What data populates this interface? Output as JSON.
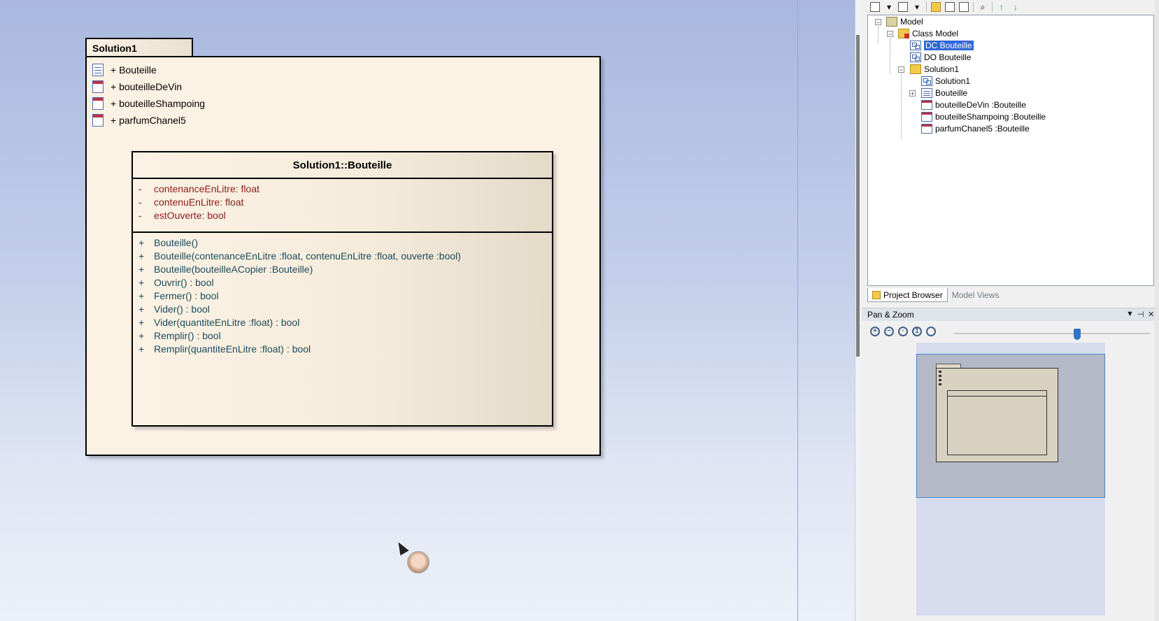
{
  "diagram": {
    "package": {
      "name": "Solution1",
      "items": [
        {
          "label": "+ Bouteille",
          "icon": "class-icon"
        },
        {
          "label": "+ bouteilleDeVin",
          "icon": "object-icon"
        },
        {
          "label": "+ bouteilleShampoing",
          "icon": "object-icon"
        },
        {
          "label": "+ parfumChanel5",
          "icon": "object-icon"
        }
      ]
    },
    "class": {
      "title": "Solution1::Bouteille",
      "attributes": [
        {
          "vis": "-",
          "text": "contenanceEnLitre:  float"
        },
        {
          "vis": "-",
          "text": "contenuEnLitre:  float"
        },
        {
          "vis": "-",
          "text": "estOuverte:  bool"
        }
      ],
      "operations": [
        {
          "vis": "+",
          "text": "Bouteille()"
        },
        {
          "vis": "+",
          "text": "Bouteille(contenanceEnLitre :float, contenuEnLitre :float, ouverte :bool)"
        },
        {
          "vis": "+",
          "text": "Bouteille(bouteilleACopier :Bouteille)"
        },
        {
          "vis": "+",
          "text": "Ouvrir() : bool"
        },
        {
          "vis": "+",
          "text": "Fermer() : bool"
        },
        {
          "vis": "+",
          "text": "Vider() : bool"
        },
        {
          "vis": "+",
          "text": "Vider(quantiteEnLitre :float) : bool"
        },
        {
          "vis": "+",
          "text": "Remplir() : bool"
        },
        {
          "vis": "+",
          "text": "Remplir(quantiteEnLitre :float) : bool"
        }
      ]
    }
  },
  "project_browser": {
    "tree": {
      "model": "Model",
      "class_model": "Class Model",
      "dc_bouteille": "DC Bouteille",
      "do_bouteille": "DO Bouteille",
      "solution1_folder": "Solution1",
      "solution1_diagram": "Solution1",
      "bouteille": "Bouteille",
      "bouteilleDeVin": "bouteilleDeVin :Bouteille",
      "bouteilleShampoing": "bouteilleShampoing :Bouteille",
      "parfumChanel5": "parfumChanel5 :Bouteille"
    },
    "selected": "DC Bouteille",
    "tabs": {
      "project_browser": "Project Browser",
      "model_views": "Model Views"
    }
  },
  "pan_zoom": {
    "title": "Pan & Zoom",
    "zoom_level": 0.6
  },
  "colors": {
    "attribute_text": "#8b1a1a",
    "operation_text": "#1a4b5c",
    "selection": "#3168d4"
  }
}
